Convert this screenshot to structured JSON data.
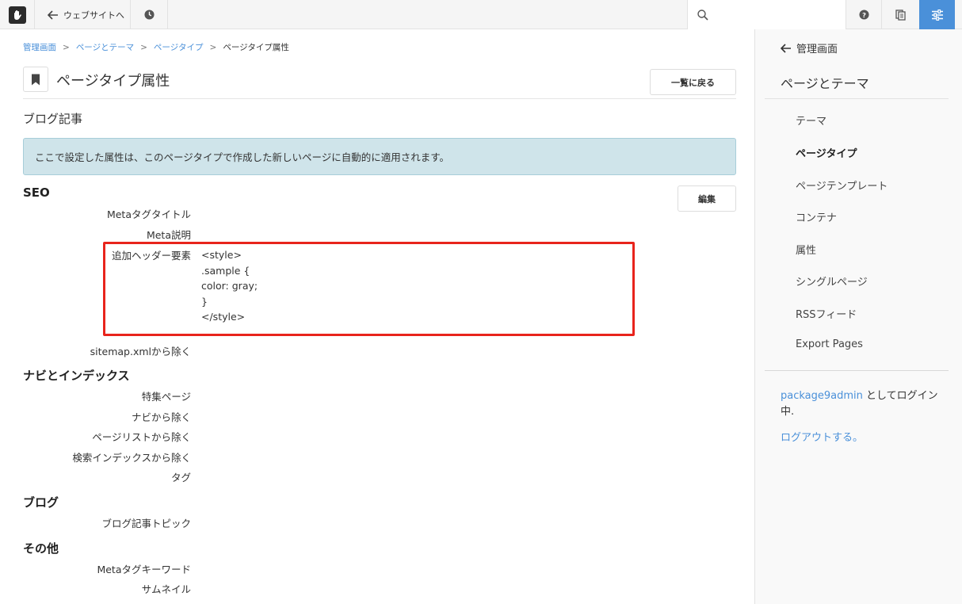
{
  "toolbar": {
    "back_label": "ウェブサイトへ",
    "search_placeholder": ""
  },
  "breadcrumb": {
    "items": [
      "管理画面",
      "ページとテーマ",
      "ページタイプ"
    ],
    "current": "ページタイプ属性",
    "separator": ">"
  },
  "header": {
    "title": "ページタイプ属性",
    "back_button": "一覧に戻る"
  },
  "subtitle": "ブログ記事",
  "info_message": "ここで設定した属性は、このページタイプで作成した新しいページに自動的に適用されます。",
  "edit_button": "編集",
  "sections": {
    "seo": {
      "title": "SEO",
      "meta_title": "Metaタグタイトル",
      "meta_description": "Meta説明",
      "header_extra": "追加ヘッダー要素",
      "header_extra_value": [
        "<style>",
        ".sample {",
        "color: gray;",
        "}",
        "</style>"
      ],
      "exclude_sitemap": "sitemap.xmlから除く"
    },
    "nav": {
      "title": "ナビとインデックス",
      "featured": "特集ページ",
      "exclude_nav": "ナビから除く",
      "exclude_page_list": "ページリストから除く",
      "exclude_search": "検索インデックスから除く",
      "tags": "タグ"
    },
    "blog": {
      "title": "ブログ",
      "topics": "ブログ記事トピック"
    },
    "other": {
      "title": "その他",
      "meta_keywords": "Metaタグキーワード",
      "thumbnail": "サムネイル"
    }
  },
  "sidebar": {
    "back_label": "管理画面",
    "title": "ページとテーマ",
    "items": [
      "テーマ",
      "ページタイプ",
      "ページテンプレート",
      "コンテナ",
      "属性",
      "シングルページ",
      "RSSフィード",
      "Export Pages"
    ],
    "active_index": 1,
    "login_user": "package9admin",
    "login_suffix": " としてログイン中.",
    "logout": "ログアウトする。"
  },
  "colors": {
    "accent": "#4a90d9",
    "info_bg": "#cfe4ea",
    "highlight": "#e8241c"
  }
}
